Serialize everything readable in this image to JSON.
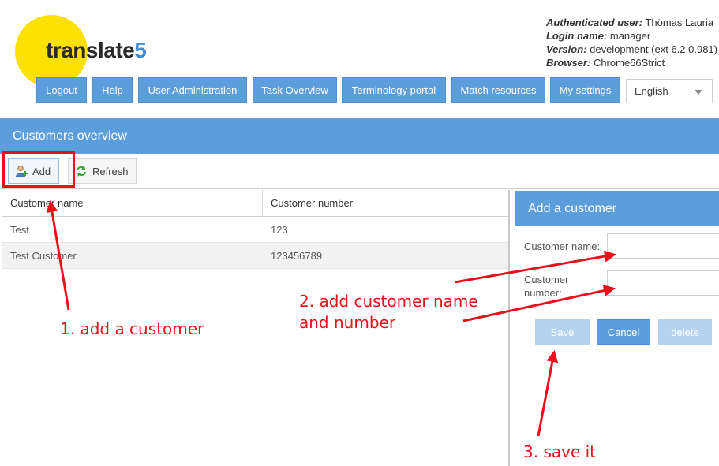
{
  "logo": {
    "text_main": "translate",
    "text_accent": "5"
  },
  "user_info": {
    "authenticated_label": "Authenticated user:",
    "authenticated_value": "Thömas Lauria",
    "login_label": "Login name:",
    "login_value": "manager",
    "version_label": "Version:",
    "version_value": "development (ext 6.2.0.981)",
    "browser_label": "Browser:",
    "browser_value": "Chrome66Strict"
  },
  "nav": {
    "logout": "Logout",
    "help": "Help",
    "user_admin": "User Administration",
    "task_overview": "Task Overview",
    "terminology": "Terminology portal",
    "match_resources": "Match resources",
    "my_settings": "My settings",
    "language": "English"
  },
  "panel": {
    "title": "Customers overview"
  },
  "toolbar": {
    "add_label": "Add",
    "refresh_label": "Refresh"
  },
  "grid": {
    "columns": [
      "Customer name",
      "Customer number"
    ],
    "rows": [
      {
        "name": "Test",
        "number": "123"
      },
      {
        "name": "Test Customer",
        "number": "123456789"
      }
    ]
  },
  "form": {
    "title": "Add a customer",
    "name_label": "Customer name:",
    "number_label_1": "Customer",
    "number_label_2": "number:",
    "name_value": "",
    "number_value": "",
    "save_label": "Save",
    "cancel_label": "Cancel",
    "delete_label": "delete"
  },
  "annotations": {
    "step1": "1. add a customer",
    "step2_line1": "2. add customer name",
    "step2_line2": "and number",
    "step3": "3. save it"
  },
  "colors": {
    "accent": "#5c9ddb",
    "annotation": "#e8101a",
    "logo_yellow": "#fbe100"
  }
}
